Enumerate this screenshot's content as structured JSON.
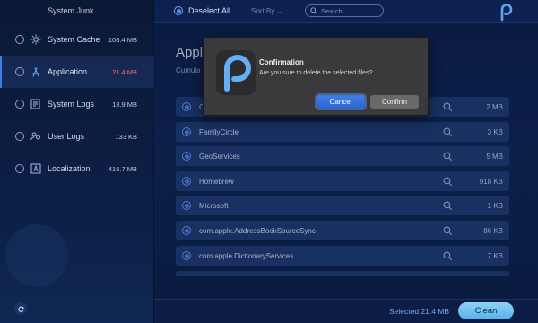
{
  "sidebar": {
    "title": "System Junk",
    "items": [
      {
        "label": "System Cache",
        "size": "108.4 MB",
        "icon": "gear-icon"
      },
      {
        "label": "Application",
        "size": "21.4 MB",
        "icon": "app-store-icon",
        "active": true
      },
      {
        "label": "System Logs",
        "size": "13.9 MB",
        "icon": "log-icon"
      },
      {
        "label": "User Logs",
        "size": "133 KB",
        "icon": "users-icon"
      },
      {
        "label": "Localization",
        "size": "415.7 MB",
        "icon": "localization-icon"
      }
    ],
    "back_icon": "back-arrow-icon"
  },
  "toolbar": {
    "deselect_label": "Deselect All",
    "sort_label": "Sort By",
    "search_placeholder": "Search"
  },
  "main": {
    "heading": "Appl",
    "subheading": "Cumula"
  },
  "list": {
    "rows": [
      {
        "name": "C",
        "size": "2 MB"
      },
      {
        "name": "FamilyCircle",
        "size": "3 KB"
      },
      {
        "name": "GeoServices",
        "size": "5 MB"
      },
      {
        "name": "Homebrew",
        "size": "918 KB"
      },
      {
        "name": "Microsoft",
        "size": "1 KB"
      },
      {
        "name": "com.apple.AddressBookSourceSync",
        "size": "86 KB"
      },
      {
        "name": "com.apple.DictionaryServices",
        "size": "7 KB"
      }
    ]
  },
  "footer": {
    "selected": "Selected 21.4 MB",
    "clean_label": "Clean"
  },
  "dialog": {
    "title": "Confirmation",
    "message": "Are you sure to delete the selected files?",
    "cancel_label": "Cancel",
    "confirm_label": "Confirm"
  },
  "colors": {
    "accent": "#4e8df5",
    "warning_size": "#ff6b6b",
    "clean_button": "#6cc3f0"
  }
}
